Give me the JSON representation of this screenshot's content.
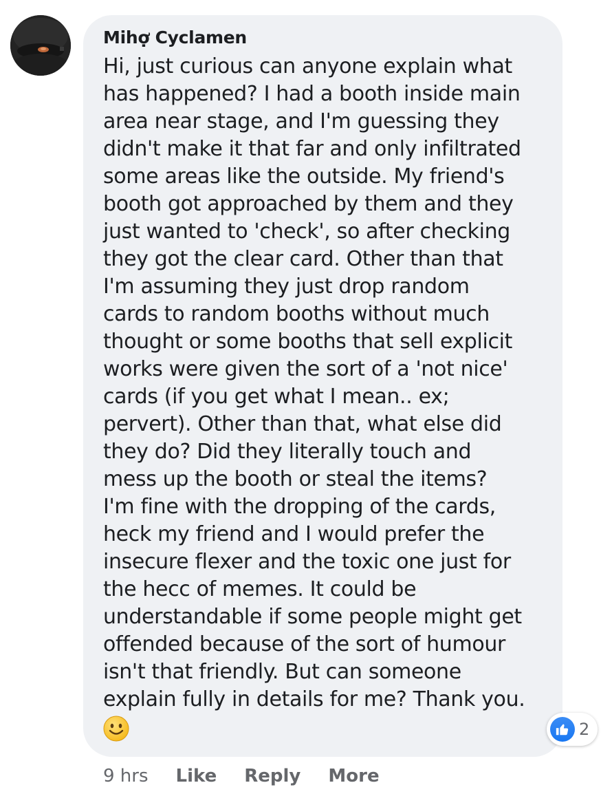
{
  "comment": {
    "author": "Mihợ Cyclamen",
    "body": "Hi, just curious can anyone explain what\nhas happened? I had a booth inside main\narea near stage, and I'm guessing they\ndidn't make it that far and only infiltrated\nsome areas like the outside. My friend's\nbooth got approached by them and they\njust wanted to 'check', so after checking\nthey got the clear card. Other than that\nI'm assuming they just drop random\ncards to random booths without much\nthought or some booths that sell explicit\nworks were given the sort of a 'not nice'\ncards (if you get what I mean.. ex;\npervert). Other than that, what else did\nthey do? Did they literally touch and\nmess up the booth or steal the items?\nI'm fine with the dropping of the cards,\nheck my friend and I would prefer the\ninsecure flexer and the toxic one just for\nthe hecc of memes. It could be\nunderstandable if some people might get\noffended because of the sort of humour\nisn't that friendly. But can someone\nexplain fully in details for me? Thank you.",
    "emoji_icon": "slightly-smiling-face-emoji",
    "reactions": {
      "icon": "thumbs-up-icon",
      "count": "2",
      "color": "#1877f2"
    }
  },
  "actions": {
    "time": "9 hrs",
    "like": "Like",
    "reply": "Reply",
    "more": "More"
  },
  "colors": {
    "bubble": "#eff1f4",
    "text": "#1c1e21",
    "muted": "#65676b"
  }
}
